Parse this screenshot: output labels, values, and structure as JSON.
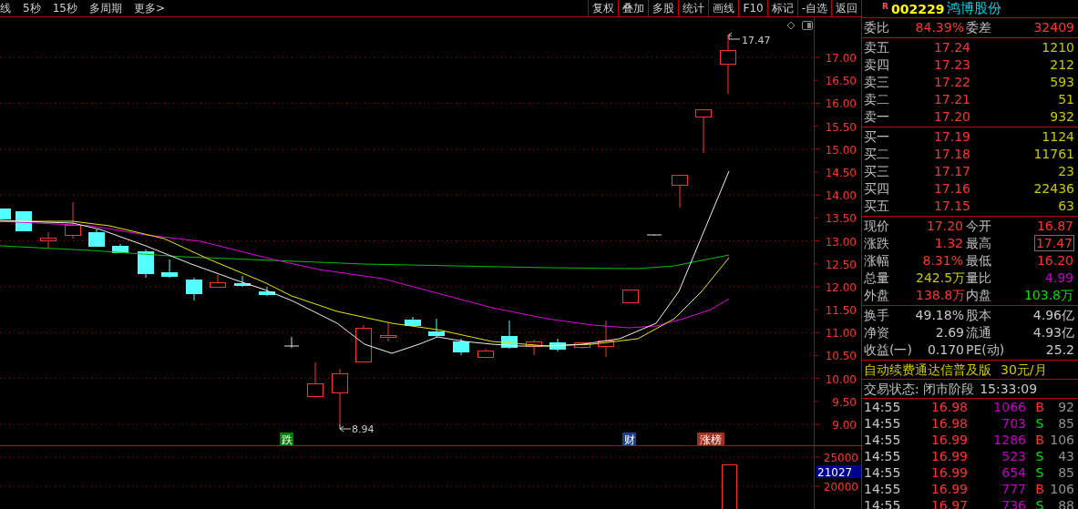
{
  "period_tabs": [
    "线",
    "5秒",
    "15秒",
    "多周期",
    "更多>"
  ],
  "toolbar_buttons": [
    "复权",
    "叠加",
    "多股",
    "统计",
    "画线",
    "F10",
    "标记",
    "-自选",
    "返回"
  ],
  "chart": {
    "price_ticks": [
      "17.00",
      "16.50",
      "16.00",
      "15.50",
      "15.00",
      "14.50",
      "14.00",
      "13.50",
      "13.00",
      "12.50",
      "12.00",
      "11.50",
      "11.00",
      "10.50",
      "10.00",
      "9.50",
      "9.00"
    ],
    "high_label": "17.47",
    "low_label": "8.94",
    "markers": [
      {
        "text": "跌",
        "color": "#008000"
      },
      {
        "text": "财",
        "color": "#1c3f8c"
      },
      {
        "text": "涨榜",
        "color": "#a03020"
      }
    ]
  },
  "volume": {
    "ticks": [
      "25000",
      "20000"
    ],
    "current": "21027"
  },
  "stock": {
    "flag": "R",
    "code": "002229",
    "name": "鸿博股份"
  },
  "order_ratio": {
    "label": "委比",
    "value": "84.39%",
    "diff_label": "委差",
    "diff": "32409"
  },
  "asks": [
    {
      "label": "卖五",
      "price": "17.24",
      "volume": "1210"
    },
    {
      "label": "卖四",
      "price": "17.23",
      "volume": "212"
    },
    {
      "label": "卖三",
      "price": "17.22",
      "volume": "593"
    },
    {
      "label": "卖二",
      "price": "17.21",
      "volume": "51"
    },
    {
      "label": "卖一",
      "price": "17.20",
      "volume": "932"
    }
  ],
  "bids": [
    {
      "label": "买一",
      "price": "17.19",
      "volume": "1124"
    },
    {
      "label": "买二",
      "price": "17.18",
      "volume": "11761"
    },
    {
      "label": "买三",
      "price": "17.17",
      "volume": "23"
    },
    {
      "label": "买四",
      "price": "17.16",
      "volume": "22436"
    },
    {
      "label": "买五",
      "price": "17.15",
      "volume": "63"
    }
  ],
  "quote": [
    {
      "label": "现价",
      "value": "17.20",
      "color": "#ff3232",
      "highlighted": false
    },
    {
      "label": "今开",
      "value": "16.87",
      "color": "#ff3232",
      "highlighted": false
    },
    {
      "label": "涨跌",
      "value": "1.32",
      "color": "#ff3232",
      "highlighted": false
    },
    {
      "label": "最高",
      "value": "17.47",
      "color": "#ff3232",
      "highlighted": true
    },
    {
      "label": "涨幅",
      "value": "8.31%",
      "color": "#ff3232",
      "highlighted": false
    },
    {
      "label": "最低",
      "value": "16.20",
      "color": "#ff3232",
      "highlighted": false
    },
    {
      "label": "总量",
      "value": "242.5万",
      "color": "#c8c800",
      "highlighted": false
    },
    {
      "label": "量比",
      "value": "4.99",
      "color": "#c000c0",
      "highlighted": false
    },
    {
      "label": "外盘",
      "value": "138.8万",
      "color": "#ff3232",
      "highlighted": false
    },
    {
      "label": "内盘",
      "value": "103.8万",
      "color": "#00e000",
      "highlighted": false
    }
  ],
  "stats": [
    {
      "label": "换手",
      "value": "49.18%"
    },
    {
      "label": "股本",
      "value": "4.96亿"
    },
    {
      "label": "净资",
      "value": "2.69"
    },
    {
      "label": "流通",
      "value": "4.93亿"
    },
    {
      "label": "收益(一)",
      "value": "0.170"
    },
    {
      "label": "PE(动)",
      "value": "25.2"
    }
  ],
  "promo": {
    "text": "自动续费通达信普及版",
    "price": "30元/月"
  },
  "status": {
    "text": "交易状态: 闭市阶段",
    "time": "15:33:09"
  },
  "trades": [
    {
      "time": "14:55",
      "price": "16.98",
      "volume": "1066",
      "side": "B",
      "color": "#ff3232",
      "count": "92"
    },
    {
      "time": "14:55",
      "price": "16.98",
      "volume": "703",
      "side": "S",
      "color": "#00e000",
      "count": "85"
    },
    {
      "time": "14:55",
      "price": "16.99",
      "volume": "1286",
      "side": "B",
      "color": "#ff3232",
      "count": "106"
    },
    {
      "time": "14:55",
      "price": "16.99",
      "volume": "523",
      "side": "S",
      "color": "#00e000",
      "count": "43"
    },
    {
      "time": "14:55",
      "price": "16.99",
      "volume": "654",
      "side": "S",
      "color": "#00e000",
      "count": "85"
    },
    {
      "time": "14:55",
      "price": "16.99",
      "volume": "777",
      "side": "B",
      "color": "#ff3232",
      "count": "106"
    },
    {
      "time": "14:55",
      "price": "16.97",
      "volume": "736",
      "side": "S",
      "color": "#00e000",
      "count": "88"
    }
  ]
}
